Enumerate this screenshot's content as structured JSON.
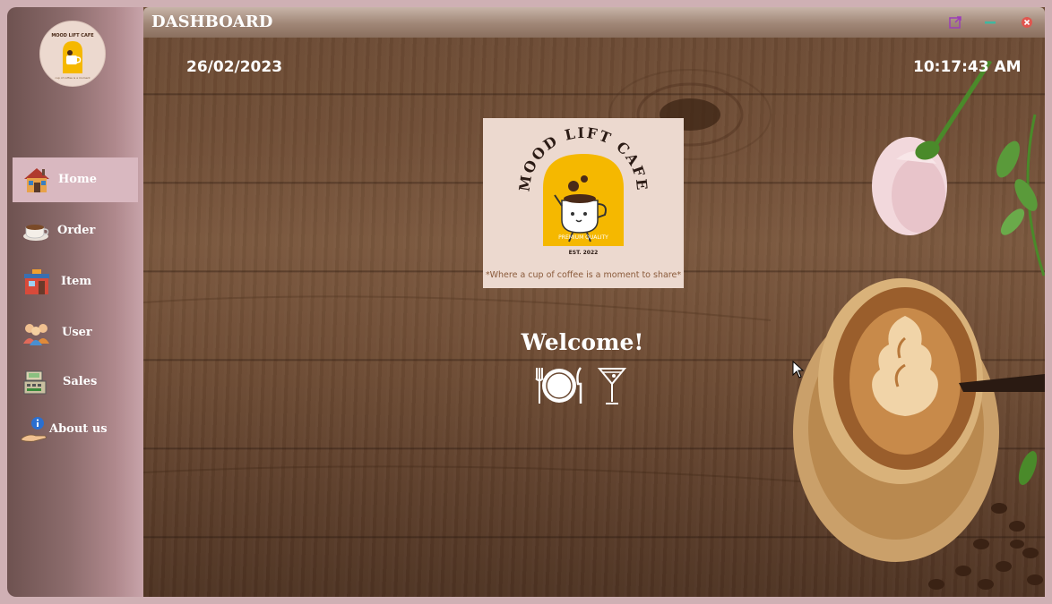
{
  "app": {
    "title": "DASHBOARD",
    "logo": {
      "brand": "MOOD LIFT CAFE",
      "tagline_small": "PREMIUM QUALITY",
      "established": "EST. 2022",
      "slogan": "*Where a cup of coffee is a moment to share*"
    }
  },
  "sidebar": {
    "items": [
      {
        "label": "Home",
        "icon": "house-icon",
        "active": true
      },
      {
        "label": "Order",
        "icon": "coffee-cup-icon",
        "active": false
      },
      {
        "label": "Item",
        "icon": "store-icon",
        "active": false
      },
      {
        "label": "User",
        "icon": "users-icon",
        "active": false
      },
      {
        "label": "Sales",
        "icon": "cash-register-icon",
        "active": false
      },
      {
        "label": "About us",
        "icon": "info-hand-icon",
        "active": false
      }
    ]
  },
  "header": {
    "date": "26/02/2023",
    "time": "10:17:43 AM",
    "window_buttons": [
      "popout-icon",
      "minimize-icon",
      "close-icon"
    ]
  },
  "main": {
    "welcome": "Welcome!",
    "icons": [
      "plate-cutlery-icon",
      "cocktail-glass-icon"
    ]
  },
  "colors": {
    "sidebar_active": "#d9b8c0",
    "logo_yellow": "#f5b800",
    "logo_bg": "#ecd9cf",
    "close_red": "#e0564f",
    "minimize_green": "#3fb8a0",
    "popout_purple": "#9b3fb8"
  }
}
